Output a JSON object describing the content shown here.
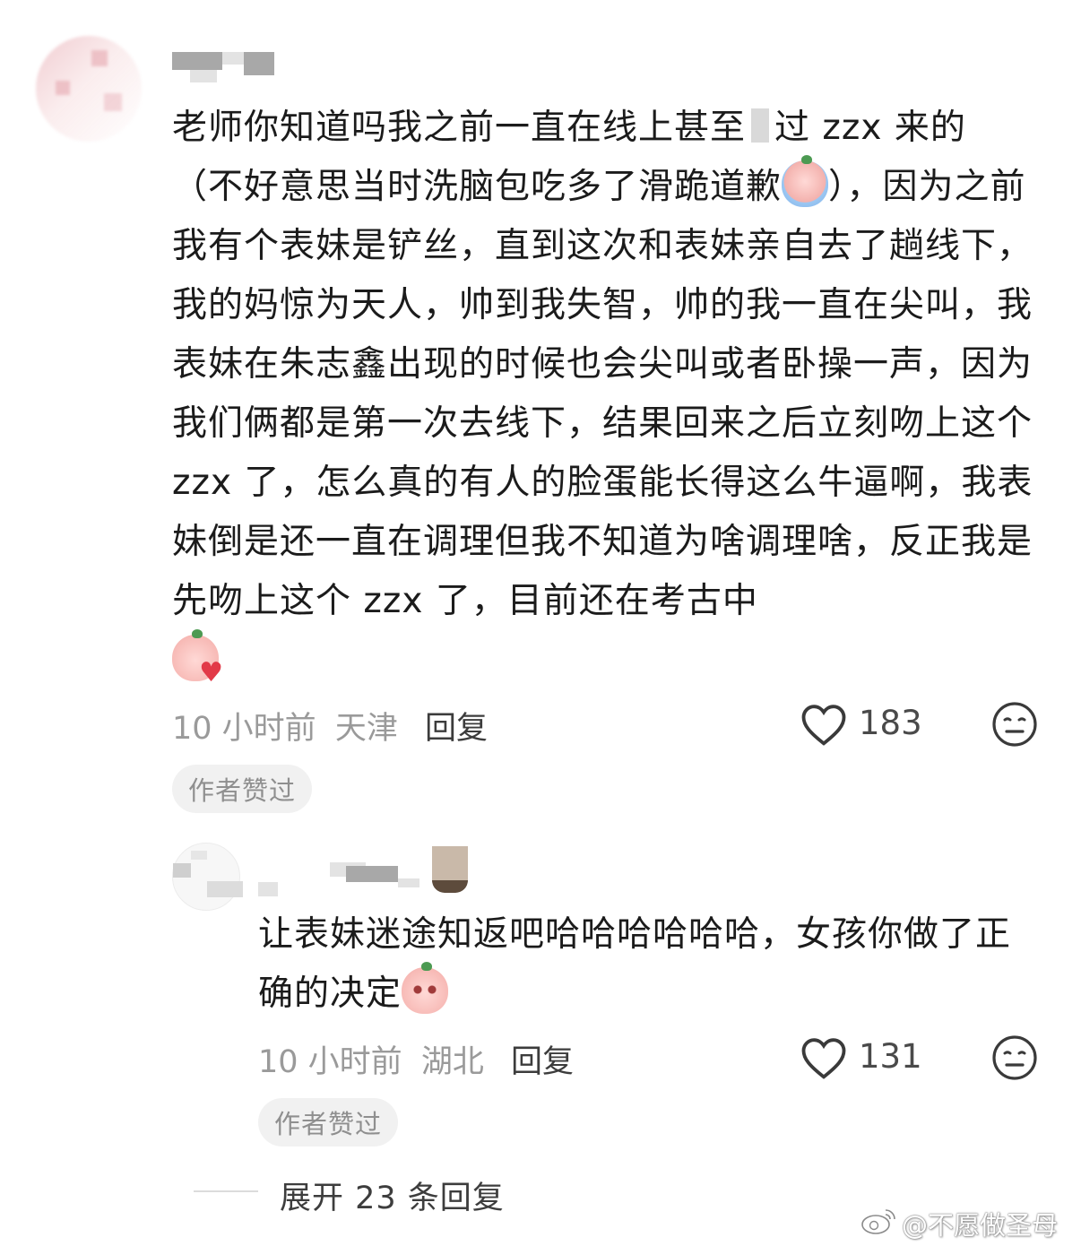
{
  "comment": {
    "text_before_mask": "老师你知道吗我之前一直在线上甚至",
    "text_after_mask": "过 zzx 来的（不好意思当时洗脑包吃多了滑跪道歉",
    "text_after_emoji1": "），因为之前我有个表妹是铲丝，直到这次和表妹亲自去了趟线下，我的妈惊为天人，帅到我失智，帅的我一直在尖叫，我表妹在朱志鑫出现的时候也会尖叫或者卧操一声，因为我们俩都是第一次去线下，结果回来之后立刻吻上这个 zzx 了，怎么真的有人的脸蛋能长得这么牛逼啊，我表妹倒是还一直在调理但我不知道为啥调理啥，反正我是先吻上这个 zzx 了，目前还在考古中",
    "emoji1": "crying-emoji",
    "emoji2": "kiss-heart-emoji",
    "time": "10 小时前",
    "location": "天津",
    "reply_label": "回复",
    "likes": "183",
    "badge": "作者赞过"
  },
  "reply": {
    "text": "让表妹迷途知返吧哈哈哈哈哈哈，女孩你做了正确的决定",
    "emoji": "pleading-emoji",
    "time": "10 小时前",
    "location": "湖北",
    "reply_label": "回复",
    "likes": "131",
    "badge": "作者赞过"
  },
  "expand_replies": "展开 23 条回复",
  "watermark": "@不愿做圣母"
}
